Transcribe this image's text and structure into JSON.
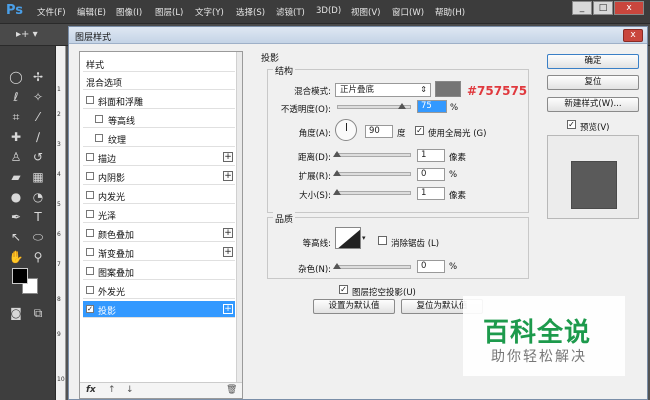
{
  "app": {
    "logo": "Ps",
    "menu": [
      "文件(F)",
      "编辑(E)",
      "图像(I)",
      "图层(L)",
      "文字(Y)",
      "选择(S)",
      "滤镜(T)",
      "3D(D)",
      "视图(V)",
      "窗口(W)",
      "帮助(H)"
    ],
    "window_buttons": [
      "_",
      "□",
      "x"
    ]
  },
  "ruler_marks": [
    "1",
    "2",
    "3",
    "4",
    "5",
    "6",
    "7",
    "8",
    "9",
    "10"
  ],
  "dialog": {
    "title": "图层样式",
    "close_label": "x",
    "style_list": {
      "items": [
        {
          "label": "样式",
          "checkbox": false,
          "indent": false,
          "checked": false,
          "plus": false,
          "selected": false
        },
        {
          "label": "混合选项",
          "checkbox": false,
          "indent": false,
          "checked": false,
          "plus": false,
          "selected": false
        },
        {
          "label": "斜面和浮雕",
          "checkbox": true,
          "indent": false,
          "checked": false,
          "plus": false,
          "selected": false
        },
        {
          "label": "等高线",
          "checkbox": true,
          "indent": true,
          "checked": false,
          "plus": false,
          "selected": false
        },
        {
          "label": "纹理",
          "checkbox": true,
          "indent": true,
          "checked": false,
          "plus": false,
          "selected": false
        },
        {
          "label": "描边",
          "checkbox": true,
          "indent": false,
          "checked": false,
          "plus": true,
          "selected": false
        },
        {
          "label": "内阴影",
          "checkbox": true,
          "indent": false,
          "checked": false,
          "plus": true,
          "selected": false
        },
        {
          "label": "内发光",
          "checkbox": true,
          "indent": false,
          "checked": false,
          "plus": false,
          "selected": false
        },
        {
          "label": "光泽",
          "checkbox": true,
          "indent": false,
          "checked": false,
          "plus": false,
          "selected": false
        },
        {
          "label": "颜色叠加",
          "checkbox": true,
          "indent": false,
          "checked": false,
          "plus": true,
          "selected": false
        },
        {
          "label": "渐变叠加",
          "checkbox": true,
          "indent": false,
          "checked": false,
          "plus": true,
          "selected": false
        },
        {
          "label": "图案叠加",
          "checkbox": true,
          "indent": false,
          "checked": false,
          "plus": false,
          "selected": false
        },
        {
          "label": "外发光",
          "checkbox": true,
          "indent": false,
          "checked": false,
          "plus": false,
          "selected": false
        },
        {
          "label": "投影",
          "checkbox": true,
          "indent": false,
          "checked": true,
          "plus": true,
          "selected": true
        }
      ],
      "footer_icons": [
        "fx",
        "↑",
        "↓",
        "🗑"
      ]
    },
    "drop_shadow": {
      "heading": "投影",
      "structure_heading": "结构",
      "blend_mode_label": "混合模式:",
      "blend_mode_value": "正片叠底",
      "shadow_color": "#757575",
      "shadow_color_annotation": "#757575",
      "annotation_color": "#e0393e",
      "opacity_label": "不透明度(O):",
      "opacity_value": "75",
      "opacity_unit": "%",
      "angle_label": "角度(A):",
      "angle_value": "90",
      "angle_unit": "度",
      "global_light_label": "使用全局光 (G)",
      "global_light_checked": true,
      "distance_label": "距离(D):",
      "distance_value": "1",
      "distance_unit": "像素",
      "spread_label": "扩展(R):",
      "spread_value": "0",
      "spread_unit": "%",
      "size_label": "大小(S):",
      "size_value": "1",
      "size_unit": "像素",
      "quality_heading": "品质",
      "contour_label": "等高线:",
      "antialias_label": "消除锯齿 (L)",
      "antialias_checked": false,
      "noise_label": "杂色(N):",
      "noise_value": "0",
      "noise_unit": "%",
      "knockout_label": "图层挖空投影(U)",
      "knockout_checked": true,
      "set_default_label": "设置为默认值",
      "reset_default_label": "复位为默认值"
    },
    "buttons": {
      "ok": "确定",
      "reset": "复位",
      "new_style": "新建样式(W)...",
      "preview_label": "预览(V)",
      "preview_checked": true
    }
  },
  "watermark": {
    "main": "百科全说",
    "sub": "助你轻松解决"
  }
}
